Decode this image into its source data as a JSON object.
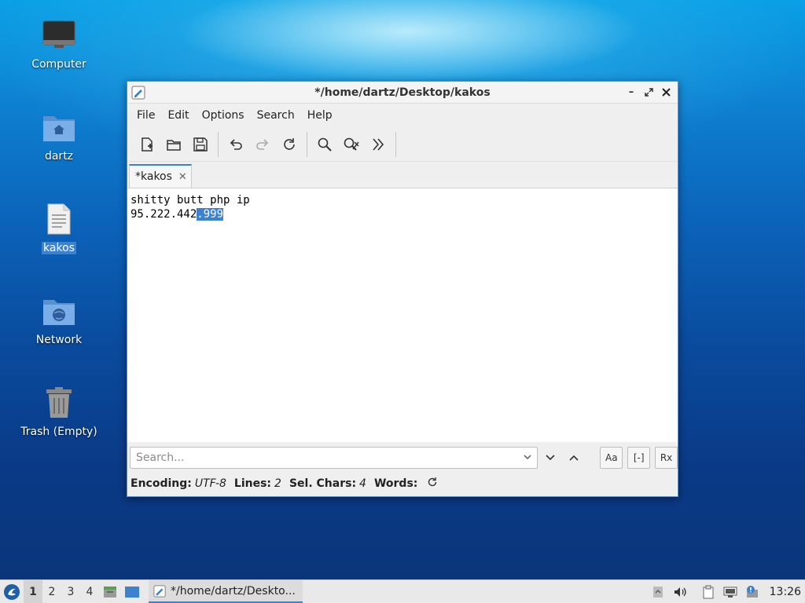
{
  "desktop": {
    "icons": [
      {
        "label": "Computer"
      },
      {
        "label": "dartz"
      },
      {
        "label": "kakos"
      },
      {
        "label": "Network"
      },
      {
        "label": "Trash (Empty)"
      }
    ]
  },
  "window": {
    "title": "*/home/dartz/Desktop/kakos",
    "menu": [
      "File",
      "Edit",
      "Options",
      "Search",
      "Help"
    ],
    "tab_label": "*kakos",
    "editor": {
      "line1": "shitty butt php ip",
      "line2_prefix": "95.222.442",
      "line2_selected": ".999"
    },
    "search": {
      "placeholder": "Search..."
    },
    "find_options": [
      "Aa",
      "[-]",
      "Rx"
    ],
    "status": {
      "encoding_label": "Encoding:",
      "encoding_value": "UTF-8",
      "lines_label": "Lines:",
      "lines_value": "2",
      "sel_label": "Sel. Chars:",
      "sel_value": "4",
      "words_label": "Words:"
    }
  },
  "taskbar": {
    "workspaces": [
      "1",
      "2",
      "3",
      "4"
    ],
    "active_task": "*/home/dartz/Deskto...",
    "clock": "13:26"
  },
  "colors": {
    "accent": "#3c82d0",
    "desktop_top": "#0aa0e6",
    "desktop_bottom": "#0b3478"
  }
}
